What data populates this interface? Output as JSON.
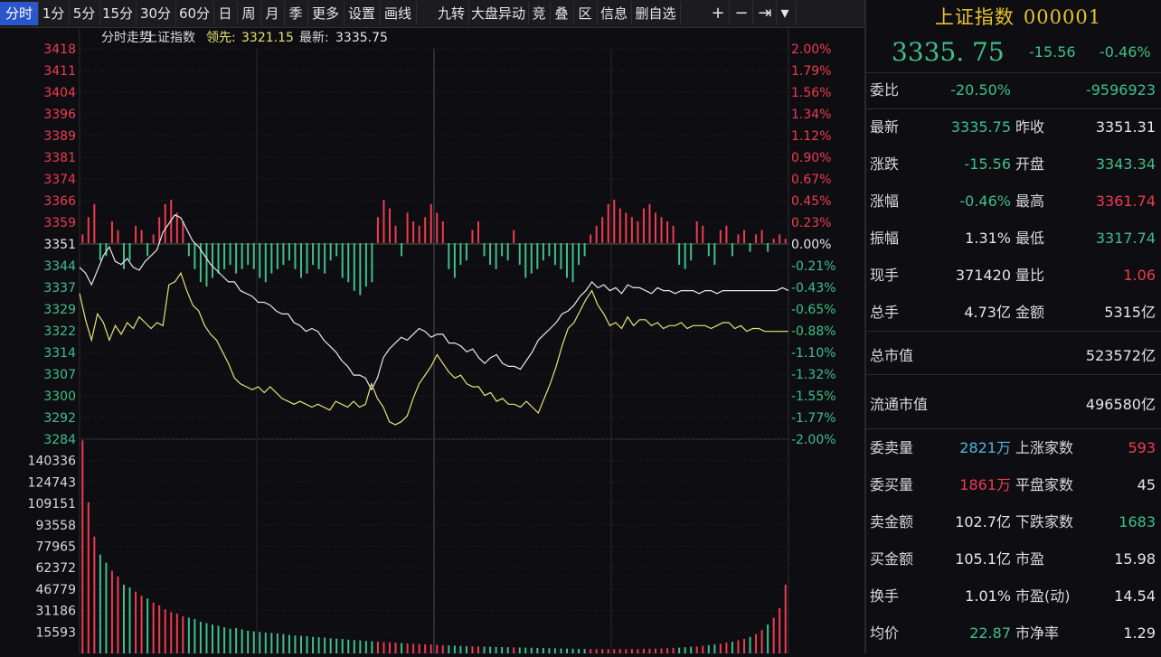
{
  "toolbar": {
    "items": [
      "分时",
      "1分",
      "5分",
      "15分",
      "30分",
      "60分",
      "日",
      "周",
      "月",
      "季",
      "更多",
      "设置",
      "画线",
      "九转",
      "大盘异动",
      "竞",
      "叠",
      "区",
      "信息",
      "删自选"
    ],
    "icons": [
      "plus-icon",
      "minus-icon",
      "skip-end-icon",
      "dropdown-icon"
    ],
    "active_index": 0
  },
  "chart_header": {
    "title": "分时走势",
    "name": "上证指数",
    "lead_label": "领先:",
    "lead_value": "3321.15",
    "latest_label": "最新:",
    "latest_value": "3335.75"
  },
  "chart_data": {
    "type": "line",
    "prev_close": 3351.31,
    "ylim": [
      3284,
      3418
    ],
    "y_ticks": [
      "3418",
      "3411",
      "3404",
      "3396",
      "3389",
      "3381",
      "3374",
      "3366",
      "3359",
      "3351",
      "3344",
      "3337",
      "3329",
      "3322",
      "3314",
      "3307",
      "3300",
      "3292",
      "3284"
    ],
    "pct_ticks": [
      "2.00%",
      "1.79%",
      "1.56%",
      "1.34%",
      "1.12%",
      "0.90%",
      "0.67%",
      "0.45%",
      "0.23%",
      "0.00%",
      "-0.21%",
      "-0.43%",
      "-0.65%",
      "-0.88%",
      "-1.10%",
      "-1.32%",
      "-1.55%",
      "-1.77%",
      "-2.00%"
    ],
    "series": [
      {
        "name": "最新",
        "color": "#e8e8e8",
        "values": [
          3343,
          3341,
          3337,
          3342,
          3347,
          3350,
          3345,
          3344,
          3346,
          3343,
          3342,
          3345,
          3347,
          3349,
          3355,
          3358,
          3361,
          3360,
          3356,
          3352,
          3350,
          3347,
          3344,
          3342,
          3340,
          3338,
          3338,
          3335,
          3334,
          3333,
          3331,
          3331,
          3330,
          3328,
          3327,
          3327,
          3324,
          3323,
          3321,
          3322,
          3321,
          3318,
          3316,
          3314,
          3311,
          3309,
          3306,
          3306,
          3305,
          3301,
          3305,
          3312,
          3315,
          3317,
          3319,
          3318,
          3320,
          3322,
          3321,
          3319,
          3320,
          3320,
          3317,
          3317,
          3316,
          3314,
          3315,
          3312,
          3310,
          3312,
          3313,
          3310,
          3309,
          3309,
          3308,
          3311,
          3314,
          3318,
          3320,
          3322,
          3324,
          3327,
          3328,
          3330,
          3333,
          3335,
          3338,
          3336,
          3337,
          3335,
          3336,
          3334,
          3337,
          3336,
          3336,
          3335,
          3334,
          3336,
          3335,
          3335,
          3334,
          3335,
          3335,
          3335,
          3334,
          3335,
          3335,
          3334,
          3335,
          3335,
          3335,
          3335,
          3335,
          3335,
          3335,
          3335,
          3335,
          3335,
          3336,
          3335
        ]
      },
      {
        "name": "领先",
        "color": "#e6e27a",
        "values": [
          3334,
          3325,
          3318,
          3327,
          3324,
          3318,
          3323,
          3320,
          3324,
          3322,
          3326,
          3324,
          3322,
          3324,
          3323,
          3337,
          3338,
          3341,
          3335,
          3330,
          3328,
          3323,
          3320,
          3318,
          3314,
          3310,
          3305,
          3303,
          3302,
          3301,
          3302,
          3300,
          3302,
          3300,
          3298,
          3297,
          3296,
          3297,
          3296,
          3295,
          3296,
          3295,
          3294,
          3297,
          3296,
          3295,
          3297,
          3295,
          3296,
          3303,
          3298,
          3295,
          3290,
          3289,
          3290,
          3292,
          3298,
          3303,
          3306,
          3309,
          3313,
          3310,
          3307,
          3305,
          3306,
          3303,
          3302,
          3302,
          3299,
          3300,
          3297,
          3298,
          3296,
          3296,
          3295,
          3297,
          3295,
          3293,
          3298,
          3303,
          3309,
          3316,
          3322,
          3324,
          3328,
          3332,
          3335,
          3330,
          3327,
          3323,
          3324,
          3322,
          3326,
          3323,
          3325,
          3325,
          3323,
          3324,
          3322,
          3323,
          3323,
          3324,
          3322,
          3323,
          3323,
          3323,
          3322,
          3323,
          3324,
          3324,
          3322,
          3323,
          3321,
          3322,
          3322,
          3321,
          3321,
          3321,
          3321,
          3321
        ]
      }
    ],
    "volume_ticks": [
      "140336",
      "124743",
      "109151",
      "93558",
      "77965",
      "62372",
      "46779",
      "31186",
      "15593"
    ],
    "volume_max": 155930,
    "volumes": [
      155000,
      110000,
      85000,
      72000,
      66000,
      60000,
      56000,
      50000,
      48000,
      45000,
      42000,
      40000,
      37000,
      35000,
      32000,
      30000,
      29000,
      27000,
      26000,
      25000,
      23000,
      22000,
      21000,
      20000,
      19000,
      18000,
      18500,
      17500,
      16500,
      16000,
      15500,
      15000,
      14800,
      14500,
      14000,
      13500,
      13000,
      12800,
      12500,
      12000,
      11800,
      11500,
      11000,
      10800,
      10500,
      10000,
      9800,
      9500,
      9000,
      8800,
      8500,
      8200,
      8000,
      7800,
      7500,
      7200,
      7000,
      6800,
      6600,
      6400,
      6200,
      6000,
      5800,
      5600,
      5400,
      5200,
      5100,
      5000,
      4900,
      4800,
      4700,
      4600,
      4500,
      4400,
      4300,
      4200,
      4100,
      4000,
      3900,
      3800,
      3700,
      3600,
      3500,
      3400,
      3300,
      3200,
      3200,
      3100,
      3100,
      3000,
      3000,
      3100,
      3000,
      3200,
      3100,
      3300,
      3400,
      3500,
      3600,
      3800,
      4000,
      4200,
      4500,
      4800,
      5000,
      5500,
      6000,
      6500,
      7000,
      7800,
      8500,
      9500,
      10500,
      12000,
      14000,
      17000,
      21000,
      26000,
      33000,
      50000
    ],
    "bars": [
      0.2,
      0.6,
      0.9,
      -0.4,
      -0.3,
      0.5,
      0.3,
      -0.6,
      -0.4,
      0.4,
      0.3,
      -0.3,
      0.2,
      0.6,
      0.9,
      1.0,
      0.7,
      0.5,
      -0.3,
      -0.6,
      -0.9,
      -1.0,
      -0.8,
      -0.7,
      -0.6,
      -0.5,
      -0.7,
      -0.6,
      -0.5,
      -0.6,
      -0.8,
      -0.9,
      -0.7,
      -0.6,
      -0.5,
      -0.4,
      -0.6,
      -0.8,
      -0.7,
      -0.5,
      -0.6,
      -0.7,
      -0.4,
      -0.3,
      -0.8,
      -0.9,
      -1.1,
      -1.2,
      -1.0,
      -0.9,
      0.6,
      1.0,
      0.8,
      0.4,
      -0.3,
      0.7,
      0.5,
      0.4,
      0.6,
      0.9,
      0.7,
      0.5,
      -0.6,
      -0.8,
      -0.5,
      -0.4,
      0.3,
      0.5,
      -0.3,
      -0.5,
      -0.6,
      -0.3,
      -0.4,
      0.3,
      -0.5,
      -0.8,
      -0.7,
      -0.6,
      -0.4,
      -0.3,
      -0.5,
      -0.6,
      -0.8,
      -0.9,
      -0.5,
      -0.3,
      0.2,
      0.4,
      0.6,
      0.9,
      1.0,
      0.8,
      0.7,
      0.6,
      0.5,
      0.8,
      0.9,
      0.7,
      0.6,
      0.5,
      0.4,
      -0.5,
      -0.6,
      -0.4,
      0.5,
      0.4,
      -0.3,
      -0.5,
      0.3,
      0.4,
      -0.3,
      0.2,
      0.3,
      -0.2,
      0.2,
      0.3,
      -0.2,
      0.1,
      0.2,
      0.1
    ]
  },
  "panel": {
    "title": "上证指数",
    "code": "000001",
    "price": "3335. 75",
    "change": "-15.56",
    "change_pct": "-0.46%",
    "rows": [
      {
        "l1": "委比",
        "v1": "-20.50%",
        "c1": "green",
        "l2": "",
        "v2": "-9596923",
        "c2": "green"
      },
      {
        "l1": "最新",
        "v1": "3335.75",
        "c1": "green",
        "l2": "昨收",
        "v2": "3351.31",
        "c2": "white"
      },
      {
        "l1": "涨跌",
        "v1": "-15.56",
        "c1": "green",
        "l2": "开盘",
        "v2": "3343.34",
        "c2": "green"
      },
      {
        "l1": "涨幅",
        "v1": "-0.46%",
        "c1": "green",
        "l2": "最高",
        "v2": "3361.74",
        "c2": "red"
      },
      {
        "l1": "振幅",
        "v1": "1.31%",
        "c1": "white",
        "l2": "最低",
        "v2": "3317.74",
        "c2": "green"
      },
      {
        "l1": "现手",
        "v1": "371420",
        "c1": "white",
        "l2": "量比",
        "v2": "1.06",
        "c2": "red"
      },
      {
        "l1": "总手",
        "v1": "4.73亿",
        "c1": "white",
        "l2": "金额",
        "v2": "5315亿",
        "c2": "white"
      },
      {
        "l1": "总市值",
        "v1": "",
        "c1": "white",
        "l2": "",
        "v2": "523572亿",
        "c2": "white"
      },
      {
        "l1": "流通市值",
        "v1": "",
        "c1": "white",
        "l2": "",
        "v2": "496580亿",
        "c2": "white"
      },
      {
        "l1": "委卖量",
        "v1": "2821万",
        "c1": "cyan",
        "l2": "上涨家数",
        "v2": "593",
        "c2": "red"
      },
      {
        "l1": "委买量",
        "v1": "1861万",
        "c1": "red",
        "l2": "平盘家数",
        "v2": "45",
        "c2": "white"
      },
      {
        "l1": "卖金额",
        "v1": "102.7亿",
        "c1": "white",
        "l2": "下跌家数",
        "v2": "1683",
        "c2": "green"
      },
      {
        "l1": "买金额",
        "v1": "105.1亿",
        "c1": "white",
        "l2": "市盈",
        "v2": "15.98",
        "c2": "white"
      },
      {
        "l1": "换手",
        "v1": "1.01%",
        "c1": "white",
        "l2": "市盈(动)",
        "v2": "14.54",
        "c2": "white"
      },
      {
        "l1": "均价",
        "v1": "22.87",
        "c1": "green",
        "l2": "市净率",
        "v2": "1.29",
        "c2": "white"
      }
    ]
  }
}
